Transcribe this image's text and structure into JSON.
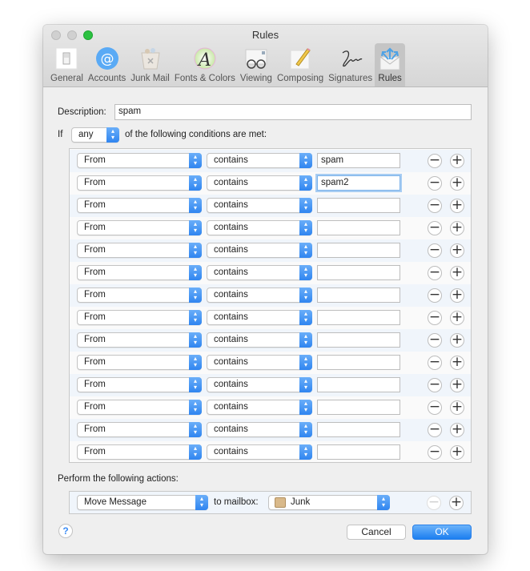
{
  "window": {
    "title": "Rules"
  },
  "toolbar": {
    "items": [
      {
        "label": "General",
        "icon": "general-switch-icon",
        "active": false
      },
      {
        "label": "Accounts",
        "icon": "at-sign-icon",
        "active": false
      },
      {
        "label": "Junk Mail",
        "icon": "trash-bin-icon",
        "active": false
      },
      {
        "label": "Fonts & Colors",
        "icon": "font-color-wheel-icon",
        "active": false
      },
      {
        "label": "Viewing",
        "icon": "glasses-envelope-icon",
        "active": false
      },
      {
        "label": "Composing",
        "icon": "pencil-paper-icon",
        "active": false
      },
      {
        "label": "Signatures",
        "icon": "signature-icon",
        "active": false
      },
      {
        "label": "Rules",
        "icon": "envelope-arrows-icon",
        "active": true
      }
    ]
  },
  "form": {
    "description_label": "Description:",
    "description_value": "spam",
    "if_label": "If",
    "match_selector": "any",
    "conditions_text": "of the following conditions are met:",
    "conditions": [
      {
        "field": "From",
        "operator": "contains",
        "value": "spam"
      },
      {
        "field": "From",
        "operator": "contains",
        "value": "spam2"
      },
      {
        "field": "From",
        "operator": "contains",
        "value": ""
      },
      {
        "field": "From",
        "operator": "contains",
        "value": ""
      },
      {
        "field": "From",
        "operator": "contains",
        "value": ""
      },
      {
        "field": "From",
        "operator": "contains",
        "value": ""
      },
      {
        "field": "From",
        "operator": "contains",
        "value": ""
      },
      {
        "field": "From",
        "operator": "contains",
        "value": ""
      },
      {
        "field": "From",
        "operator": "contains",
        "value": ""
      },
      {
        "field": "From",
        "operator": "contains",
        "value": ""
      },
      {
        "field": "From",
        "operator": "contains",
        "value": ""
      },
      {
        "field": "From",
        "operator": "contains",
        "value": ""
      },
      {
        "field": "From",
        "operator": "contains",
        "value": ""
      },
      {
        "field": "From",
        "operator": "contains",
        "value": ""
      }
    ],
    "actions_label": "Perform the following actions:",
    "action": {
      "type": "Move Message",
      "to_label": "to mailbox:",
      "mailbox": "Junk"
    },
    "remove_symbol": "−",
    "add_symbol": "+"
  },
  "buttons": {
    "help": "?",
    "cancel": "Cancel",
    "ok": "OK"
  },
  "colors": {
    "accent": "#2f85f0",
    "focus_ring": "#a8cdf3",
    "zoom_button": "#2bc140"
  }
}
